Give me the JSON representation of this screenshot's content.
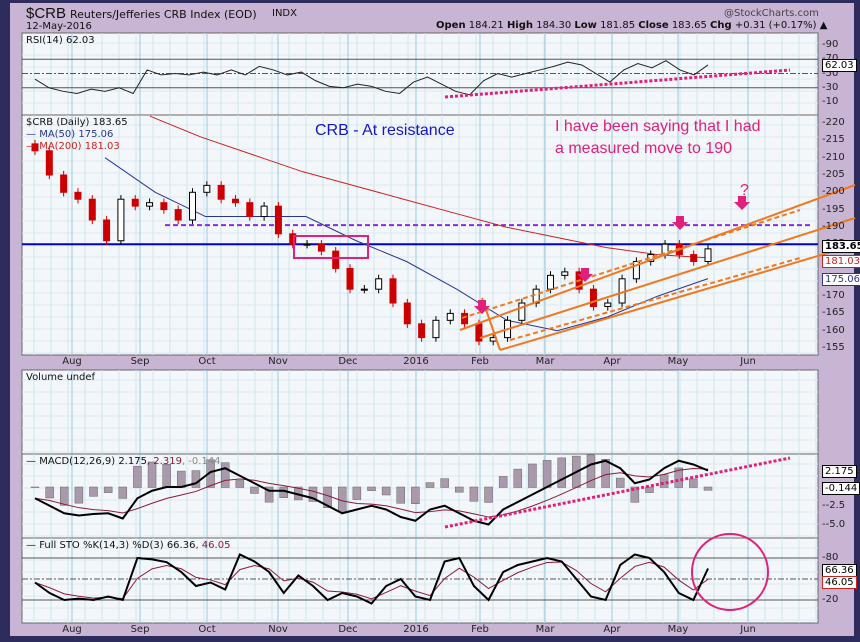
{
  "header": {
    "symbol": "$CRB",
    "name": "Reuters/Jefferies CRB Index (EOD)",
    "exchange": "INDX",
    "date": "12-May-2016",
    "watermark": "@StockCharts.com",
    "open_label": "Open",
    "open": "184.21",
    "high_label": "High",
    "high": "184.30",
    "low_label": "Low",
    "low": "181.85",
    "close_label": "Close",
    "close": "183.65",
    "chg_label": "Chg",
    "chg": "+0.31 (+0.17%)"
  },
  "annotations": {
    "title": "CRB -  At resistance",
    "note1": "I have been saying that I had",
    "note2": "a measured move to 190",
    "question": "?"
  },
  "colors": {
    "up": "#ffffff",
    "down": "#cc0000",
    "ma50": "#2a3590",
    "ma200": "#cc2222",
    "resistance": "#0000cc",
    "target": "#8a2be2",
    "channel": "#f07820",
    "annot": "#e0207a"
  },
  "chart_data": [
    {
      "type": "line",
      "name": "RSI",
      "legend": "RSI(14) 62.03",
      "ylim": [
        0,
        100
      ],
      "ticks": [
        "90",
        "70",
        "50",
        "30",
        "10"
      ],
      "tick_values": [
        90,
        70,
        50,
        30,
        10
      ],
      "current": "62.03",
      "values": [
        42,
        30,
        25,
        22,
        28,
        25,
        30,
        22,
        55,
        48,
        50,
        48,
        52,
        48,
        55,
        48,
        60,
        55,
        48,
        52,
        40,
        32,
        30,
        35,
        32,
        25,
        22,
        38,
        45,
        35,
        25,
        20,
        40,
        50,
        45,
        50,
        55,
        60,
        66,
        62,
        50,
        38,
        55,
        64,
        58,
        68,
        55,
        48,
        62
      ]
    },
    {
      "type": "candlestick",
      "name": "Price",
      "legend": "$CRB (Daily) 183.65",
      "ma50_legend": "MA(50) 175.06",
      "ma200_legend": "MA(200) 181.03",
      "ylim": [
        153,
        222
      ],
      "ticks": [
        "220",
        "215",
        "210",
        "205",
        "200",
        "195",
        "190",
        "185",
        "180",
        "175",
        "170",
        "165",
        "160",
        "155"
      ],
      "tick_values": [
        220,
        215,
        210,
        205,
        200,
        195,
        190,
        185,
        180,
        175,
        170,
        165,
        160,
        155
      ],
      "current": "183.65",
      "ma200_current": "181.03",
      "ma50_current": "175.06",
      "resistance": 185,
      "target": 190.5,
      "closes": [
        212,
        205,
        200,
        198,
        192,
        186,
        198,
        196,
        197,
        195,
        192,
        200,
        202,
        198,
        197,
        193,
        196,
        188,
        185,
        185,
        183,
        178,
        172,
        172,
        175,
        168,
        162,
        158,
        163,
        165,
        162,
        157,
        158,
        163,
        168,
        172,
        176,
        177,
        172,
        167,
        168,
        175,
        180,
        182,
        185,
        182,
        180,
        183.65
      ],
      "ma50": [
        210,
        200,
        193,
        193,
        193,
        186,
        180,
        172,
        163,
        160,
        164,
        170,
        175.06
      ],
      "ma200": [
        222,
        216,
        211,
        206,
        202,
        198,
        194,
        190,
        187,
        184,
        182,
        181.03
      ]
    },
    {
      "type": "bar",
      "name": "Volume",
      "legend": "Volume undef",
      "values": []
    },
    {
      "type": "line",
      "name": "MACD",
      "legend_main": "MACD(12,26,9) 2.175",
      "legend_signal": ", 2.319",
      "legend_hist": ", -0.144",
      "ylim": [
        -6,
        4
      ],
      "ticks": [
        "-2.5",
        "-5.0"
      ],
      "tick_values": [
        -2.5,
        -5.0
      ],
      "current_macd": "2.175",
      "current_hist": "-0.144",
      "values": [
        -1.5,
        -2.5,
        -3.5,
        -3.8,
        -3.6,
        -3.5,
        -4.2,
        -1.5,
        -0.5,
        0,
        0,
        0.5,
        2,
        2.5,
        1.5,
        0.5,
        -0.5,
        -0.5,
        -1,
        -1.5,
        -2.5,
        -3.5,
        -3,
        -2.5,
        -3,
        -4,
        -4.5,
        -3,
        -2.5,
        -3.5,
        -4.5,
        -5,
        -3,
        -2,
        -1,
        0,
        1,
        2,
        3,
        3.5,
        2.5,
        0.5,
        1,
        2.5,
        3.5,
        3,
        2.2
      ]
    },
    {
      "type": "line",
      "name": "Full STO",
      "legend_main": "Full STO %K(14,3) %D(3) 66.36",
      "legend_d": ", 46.05",
      "ylim": [
        0,
        100
      ],
      "ticks": [
        "80",
        "20"
      ],
      "tick_values": [
        80,
        20
      ],
      "current_k": "66.36",
      "current_d": "46.05",
      "values": [
        45,
        30,
        20,
        22,
        20,
        25,
        20,
        80,
        78,
        74,
        60,
        40,
        45,
        35,
        85,
        75,
        60,
        30,
        55,
        40,
        20,
        30,
        25,
        15,
        40,
        50,
        25,
        20,
        75,
        80,
        40,
        20,
        60,
        70,
        75,
        80,
        75,
        50,
        25,
        20,
        70,
        85,
        80,
        60,
        30,
        20,
        65
      ]
    }
  ],
  "x_axis": {
    "months": [
      "Aug",
      "Sep",
      "Oct",
      "Nov",
      "Dec",
      "2016",
      "Feb",
      "Mar",
      "Apr",
      "May",
      "Jun"
    ]
  }
}
